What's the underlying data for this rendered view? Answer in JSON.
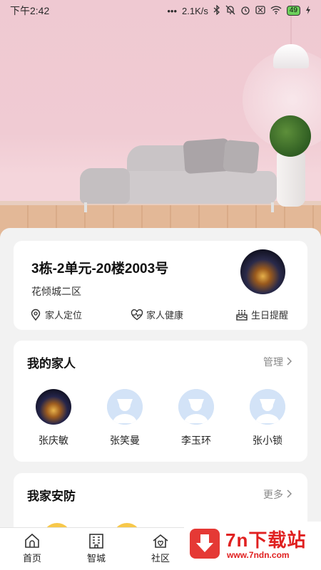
{
  "status_bar": {
    "time": "下午2:42",
    "network_speed": "2.1K/s",
    "battery": "49"
  },
  "home": {
    "address": "3栋-2单元-20楼2003号",
    "community": "花倾城二区",
    "actions": [
      {
        "label": "家人定位",
        "icon": "location-pin-icon"
      },
      {
        "label": "家人健康",
        "icon": "heart-pulse-icon"
      },
      {
        "label": "生日提醒",
        "icon": "birthday-cake-icon"
      }
    ]
  },
  "family": {
    "title": "我的家人",
    "manage_label": "管理",
    "members": [
      {
        "name": "张庆敏",
        "avatar": "photo"
      },
      {
        "name": "张笑曼",
        "avatar": "default"
      },
      {
        "name": "李玉环",
        "avatar": "default"
      },
      {
        "name": "张小锁",
        "avatar": "default"
      }
    ]
  },
  "security": {
    "title": "我家安防",
    "more_label": "更多"
  },
  "bottom_nav": {
    "tabs": [
      {
        "label": "首页",
        "icon": "home-icon"
      },
      {
        "label": "智城",
        "icon": "building-icon"
      },
      {
        "label": "社区",
        "icon": "community-icon"
      }
    ]
  },
  "watermark": {
    "title": "7n下载站",
    "url": "www.7ndn.com"
  },
  "colors": {
    "hero_pink": "#efc9d2",
    "watermark_red": "#e02020",
    "accent_yellow": "#f7c84a"
  }
}
